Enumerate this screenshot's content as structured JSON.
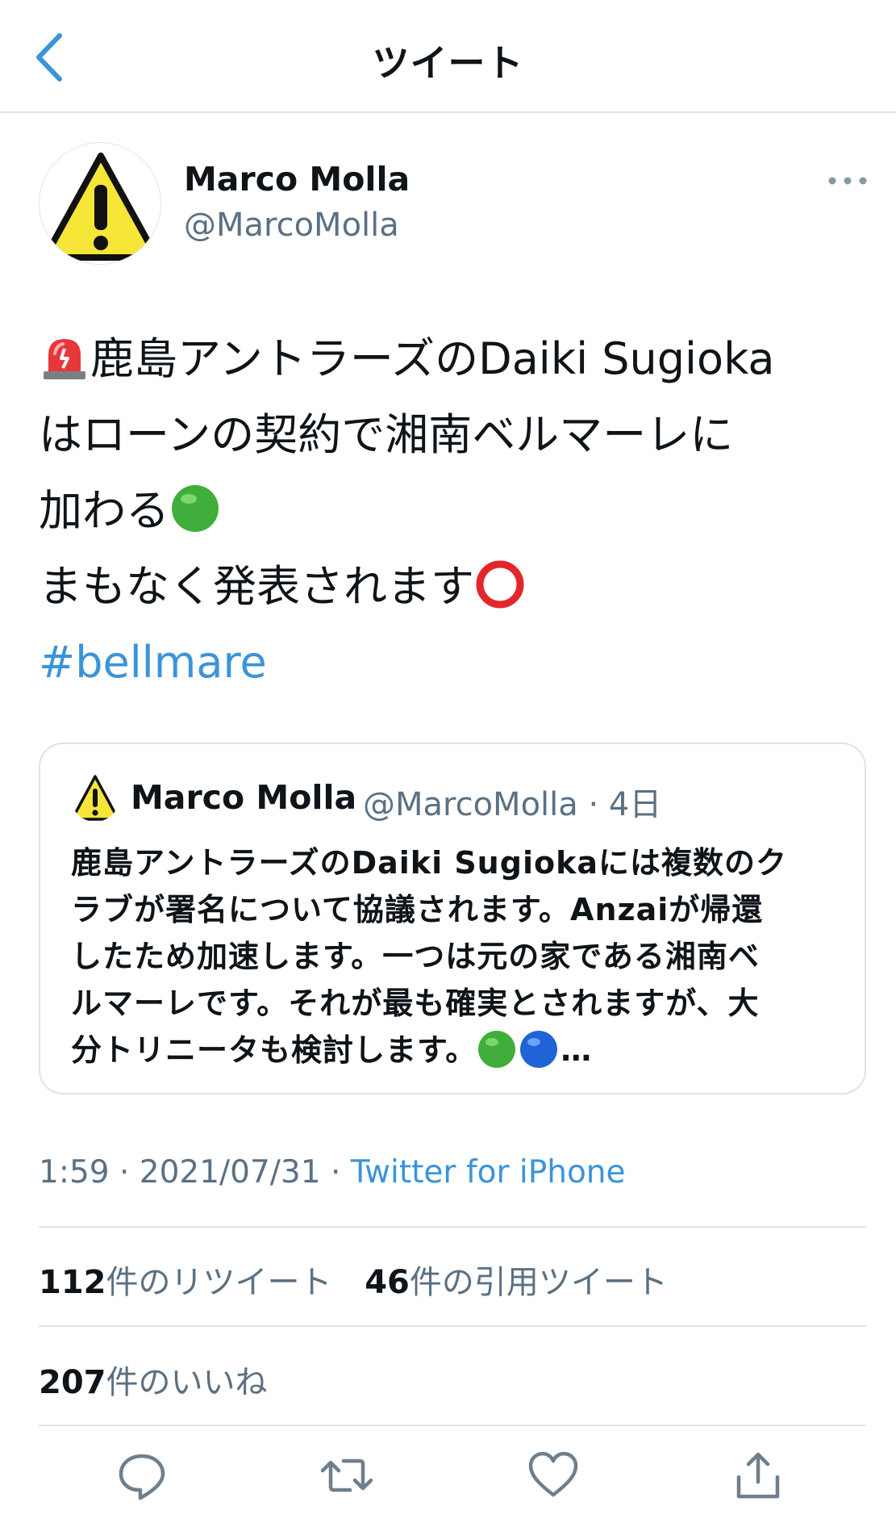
{
  "header": {
    "title": "ツイート"
  },
  "author": {
    "name": "Marco Molla",
    "handle": "@MarcoMolla"
  },
  "tweet": {
    "line1_text": "鹿島アントラーズのDaiki Sugioka",
    "line2_text": "はローンの契約で湘南ベルマーレに",
    "line3_text": "加わる",
    "line4_text": "まもなく発表されます",
    "hashtag": "#bellmare"
  },
  "quote": {
    "name": "Marco Molla",
    "handle_time": "@MarcoMolla · 4日",
    "text": "鹿島アントラーズのDaiki Sugiokaには複数のク\nラブが署名について協議されます。Anzaiが帰還\nしたため加速します。一つは元の家である湘南ベ\nルマーレです。それが最も確実とされますが、大\n分トリニータも検討します。",
    "ellipsis": "…"
  },
  "meta": {
    "time": "1:59 · 2021/07/31 · ",
    "source": "Twitter for iPhone"
  },
  "stats": {
    "retweets_count": "112",
    "retweets_label": "件のリツイート",
    "quotes_count": "46",
    "quotes_label": "件の引用ツイート",
    "likes_count": "207",
    "likes_label": "件のいいね"
  },
  "icons": {
    "back": "chevron-left-icon",
    "more": "more-dots-icon",
    "reply": "reply-icon",
    "retweet": "retweet-icon",
    "like": "heart-icon",
    "share": "share-icon"
  },
  "colors": {
    "link": "#3b94d9",
    "secondary": "#5b7083",
    "text": "#0f1419",
    "border": "#dfe3e6"
  }
}
